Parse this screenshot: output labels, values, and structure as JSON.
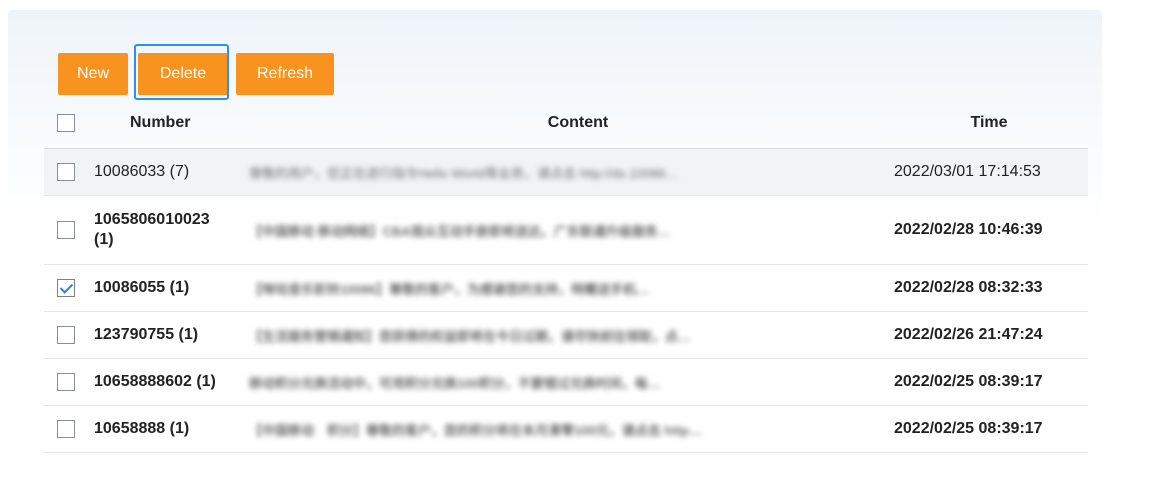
{
  "toolbar": {
    "new_label": "New",
    "delete_label": "Delete",
    "refresh_label": "Refresh"
  },
  "table": {
    "headers": {
      "number": "Number",
      "content": "Content",
      "time": "Time"
    },
    "rows": [
      {
        "number": "10086033 (7)",
        "content": "尊敬的用户，您正在进行指令Hello World等业务，请点击 http://dx.10086…",
        "time": "2022/03/01 17:14:53",
        "checked": false,
        "bold": false
      },
      {
        "number": "1065806010023 (1)",
        "content": "【中国移动 移动网络】CBA观众互动手册即将送达，广东联通升级服务…",
        "time": "2022/02/28 10:46:39",
        "checked": false,
        "bold": true
      },
      {
        "number": "10086055 (1)",
        "content": "【咪咕音乐彩铃10086】尊敬的客户，为感谢您的支持，特赠送手机…",
        "time": "2022/02/28 08:32:33",
        "checked": true,
        "bold": true
      },
      {
        "number": "123790755 (1)",
        "content": "【生活服务营销通知】您获得的权益即将在今日过期，请尽快前往领取，点…",
        "time": "2022/02/26 21:47:24",
        "checked": false,
        "bold": true
      },
      {
        "number": "10658888602 (1)",
        "content": "移动积分兑换活动中，可用积分兑换100积分，不要错过兑换时间，每…",
        "time": "2022/02/25 08:39:17",
        "checked": false,
        "bold": true
      },
      {
        "number": "10658888 (1)",
        "content": "【中国移动　积分】尊敬的客户，您的积分将在本月清零100元，请点击 http…",
        "time": "2022/02/25 08:39:17",
        "checked": false,
        "bold": true
      }
    ]
  }
}
